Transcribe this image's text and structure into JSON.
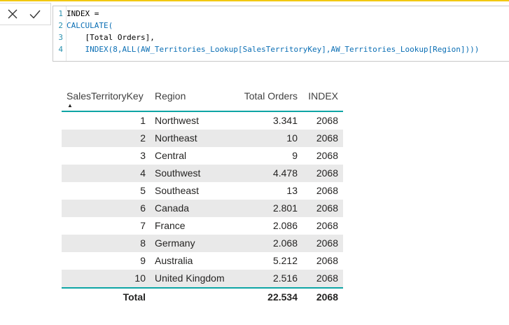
{
  "formula_bar": {
    "cancel_icon": "x-icon",
    "commit_icon": "checkmark-icon",
    "lines": [
      {
        "number": "1",
        "text": "INDEX =",
        "fn": false
      },
      {
        "number": "2",
        "text": "CALCULATE(",
        "fn": true
      },
      {
        "number": "3",
        "text": "    [Total Orders],",
        "fn": false
      },
      {
        "number": "4",
        "text": "    INDEX(8,ALL(AW_Territories_Lookup[SalesTerritoryKey],AW_Territories_Lookup[Region])))",
        "fn": true
      }
    ]
  },
  "table": {
    "columns": [
      "SalesTerritoryKey",
      "Region",
      "Total Orders",
      "INDEX"
    ],
    "sort_indicator": "▲",
    "rows": [
      {
        "key": "1",
        "region": "Northwest",
        "orders": "3.341",
        "index": "2068"
      },
      {
        "key": "2",
        "region": "Northeast",
        "orders": "10",
        "index": "2068"
      },
      {
        "key": "3",
        "region": "Central",
        "orders": "9",
        "index": "2068"
      },
      {
        "key": "4",
        "region": "Southwest",
        "orders": "4.478",
        "index": "2068"
      },
      {
        "key": "5",
        "region": "Southeast",
        "orders": "13",
        "index": "2068"
      },
      {
        "key": "6",
        "region": "Canada",
        "orders": "2.801",
        "index": "2068"
      },
      {
        "key": "7",
        "region": "France",
        "orders": "2.086",
        "index": "2068"
      },
      {
        "key": "8",
        "region": "Germany",
        "orders": "2.068",
        "index": "2068"
      },
      {
        "key": "9",
        "region": "Australia",
        "orders": "5.212",
        "index": "2068"
      },
      {
        "key": "10",
        "region": "United Kingdom",
        "orders": "2.516",
        "index": "2068"
      }
    ],
    "total": {
      "label": "Total",
      "orders": "22.534",
      "index": "2068"
    }
  },
  "colors": {
    "accent": "#0ea5a5",
    "band": "#e9e9e9",
    "code_fn": "#0a6eb4",
    "line_number": "#2b91af",
    "top_line": "#f2c811"
  }
}
